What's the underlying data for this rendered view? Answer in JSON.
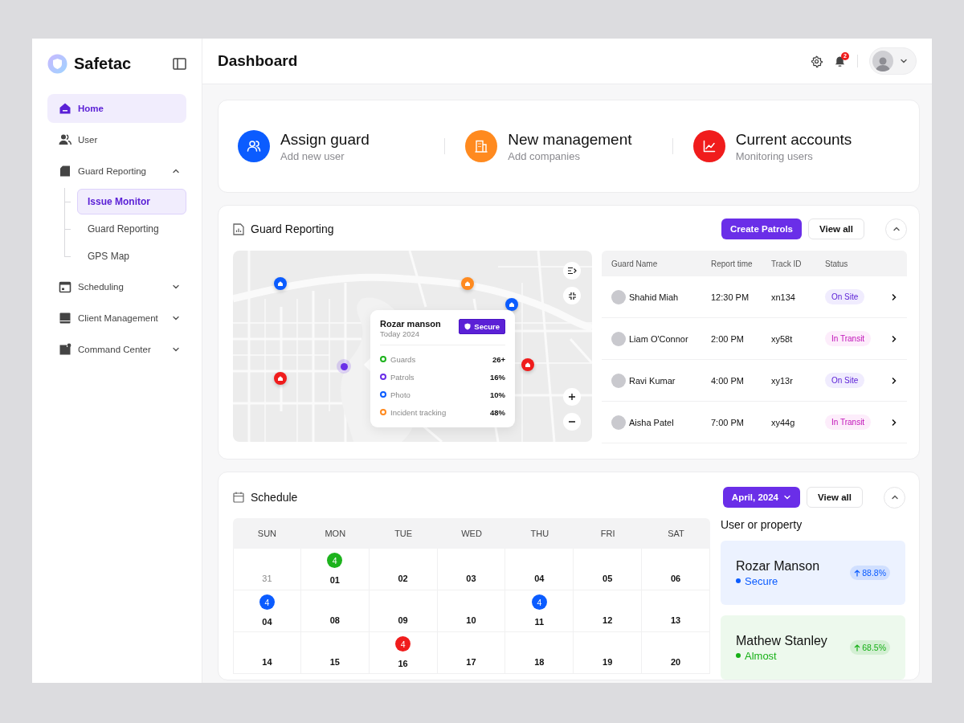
{
  "sidebar": {
    "brand": "Safetac",
    "items": [
      {
        "label": "Home",
        "selected": true
      },
      {
        "label": "User",
        "selected": false
      },
      {
        "label": "Guard Reporting",
        "selected": false,
        "expanded": true,
        "children": [
          {
            "label": "Issue Monitor",
            "selected": true
          },
          {
            "label": "Guard Reporting",
            "selected": false
          },
          {
            "label": "GPS Map",
            "selected": false
          }
        ]
      },
      {
        "label": "Scheduling",
        "selected": false,
        "expanded": false
      },
      {
        "label": "Client Management",
        "selected": false,
        "expanded": false
      },
      {
        "label": "Command Center",
        "selected": false,
        "expanded": false
      }
    ]
  },
  "topbar": {
    "title": "Dashboard",
    "notifications": "2"
  },
  "quick_actions": [
    {
      "title": "Assign guard",
      "subtitle": "Add new user",
      "color": "#0b5cff"
    },
    {
      "title": "New management",
      "subtitle": "Add companies",
      "color": "#ff8a1f"
    },
    {
      "title": "Current accounts",
      "subtitle": "Monitoring users",
      "color": "#f01c1c"
    }
  ],
  "guard_reporting": {
    "title": "Guard Reporting",
    "buttons": [
      "Create Patrols",
      "View all"
    ],
    "map": {
      "pins": [
        {
          "color": "#0b5cff"
        },
        {
          "color": "#ff8a1f"
        },
        {
          "color": "#0b5cff"
        },
        {
          "color": "#f01c1c"
        },
        {
          "color": "#f01c1c"
        }
      ],
      "popup": {
        "name": "Rozar manson",
        "date": "Today 2024",
        "badge": "Secure",
        "stats": [
          {
            "label": "Guards",
            "value": "26+",
            "color": "#1db31d"
          },
          {
            "label": "Patrols",
            "value": "16%",
            "color": "#6a2ee8"
          },
          {
            "label": "Photo",
            "value": "10%",
            "color": "#0b5cff"
          },
          {
            "label": "Incident tracking",
            "value": "48%",
            "color": "#ff8a1f"
          }
        ]
      }
    },
    "table": {
      "columns": [
        "Guard Name",
        "Report time",
        "Track ID",
        "Status"
      ],
      "rows": [
        {
          "name": "Shahid Miah",
          "time": "12:30 PM",
          "track": "xn134",
          "status": {
            "label": "On Site",
            "kind": "on-site"
          }
        },
        {
          "name": "Liam O'Connor",
          "time": "2:00 PM",
          "track": "xy58t",
          "status": {
            "label": "In Transit",
            "kind": "in-transit"
          }
        },
        {
          "name": "Ravi Kumar",
          "time": "4:00 PM",
          "track": "xy13r",
          "status": {
            "label": "On Site",
            "kind": "on-site"
          }
        },
        {
          "name": "Aisha Patel",
          "time": "7:00 PM",
          "track": "xy44g",
          "status": {
            "label": "In Transit",
            "kind": "in-transit"
          }
        }
      ]
    }
  },
  "schedule": {
    "title": "Schedule",
    "month": "April, 2024",
    "view_all": "View all",
    "calendar": {
      "weekdays": [
        "SUN",
        "MON",
        "TUE",
        "WED",
        "THU",
        "FRI",
        "SAT"
      ],
      "weeks": [
        [
          {
            "day": "31",
            "muted": true
          },
          {
            "day": "01",
            "muted": false,
            "badge": {
              "count": "4",
              "color": "#1db31d"
            }
          },
          {
            "day": "02",
            "muted": false
          },
          {
            "day": "03",
            "muted": false
          },
          {
            "day": "04",
            "muted": false
          },
          {
            "day": "05",
            "muted": false
          },
          {
            "day": "06",
            "muted": false
          }
        ],
        [
          {
            "day": "04",
            "muted": false,
            "badge": {
              "count": "4",
              "color": "#0b5cff"
            }
          },
          {
            "day": "08",
            "muted": false
          },
          {
            "day": "09",
            "muted": false
          },
          {
            "day": "10",
            "muted": false
          },
          {
            "day": "11",
            "muted": false,
            "badge": {
              "count": "4",
              "color": "#0b5cff"
            }
          },
          {
            "day": "12",
            "muted": false
          },
          {
            "day": "13",
            "muted": false
          }
        ],
        [
          {
            "day": "14",
            "muted": false
          },
          {
            "day": "15",
            "muted": false
          },
          {
            "day": "16",
            "muted": false,
            "badge": {
              "count": "4",
              "color": "#f01c1c"
            }
          },
          {
            "day": "17",
            "muted": false
          },
          {
            "day": "18",
            "muted": false
          },
          {
            "day": "19",
            "muted": false
          },
          {
            "day": "20",
            "muted": false
          }
        ]
      ]
    },
    "panel_title": "User or property",
    "properties": [
      {
        "name": "Rozar Manson",
        "status": "Secure",
        "change": "88.8%",
        "color": "#0b5cff"
      },
      {
        "name": "Mathew Stanley",
        "status": "Almost",
        "change": "68.5%",
        "color": "#16b016"
      }
    ]
  }
}
